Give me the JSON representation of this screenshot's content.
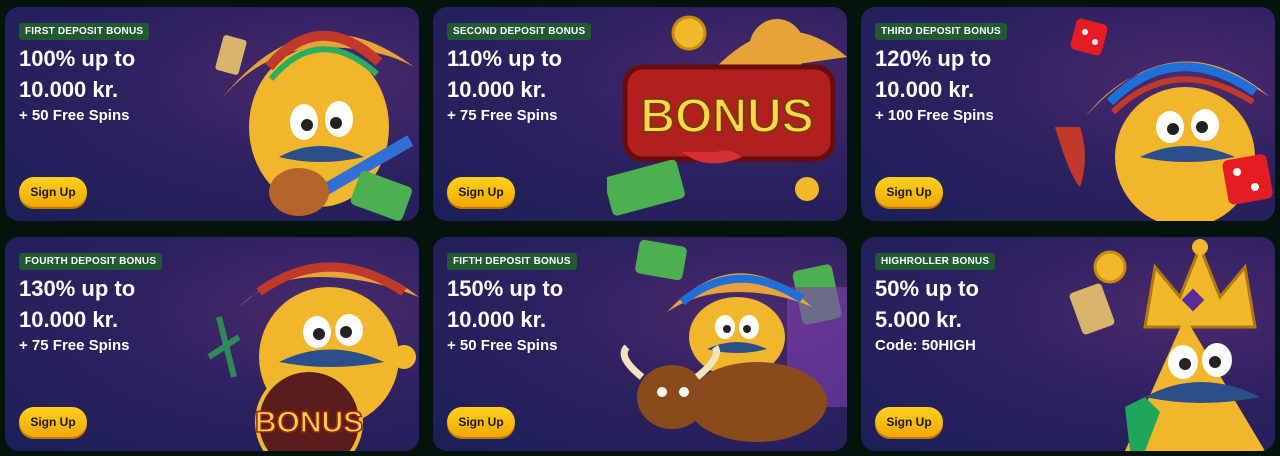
{
  "cards": [
    {
      "badge": "FIRST DEPOSIT BONUS",
      "line1": "100% up to",
      "line2": "10.000 kr.",
      "extra": "+ 50 Free Spins",
      "cta": "Sign Up"
    },
    {
      "badge": "SECOND DEPOSIT BONUS",
      "line1": "110% up to",
      "line2": "10.000 kr.",
      "extra": "+ 75 Free Spins",
      "cta": "Sign Up",
      "art_text": "BONUS"
    },
    {
      "badge": "THIRD DEPOSIT BONUS",
      "line1": "120% up to",
      "line2": "10.000 kr.",
      "extra": "+ 100 Free Spins",
      "cta": "Sign Up"
    },
    {
      "badge": "FOURTH DEPOSIT BONUS",
      "line1": "130% up to",
      "line2": "10.000 kr.",
      "extra": "+ 75 Free Spins",
      "cta": "Sign Up",
      "art_text": "BONUS"
    },
    {
      "badge": "FIFTH DEPOSIT BONUS",
      "line1": "150% up to",
      "line2": "10.000 kr.",
      "extra": "+ 50 Free Spins",
      "cta": "Sign Up"
    },
    {
      "badge": "HIGHROLLER BONUS",
      "line1": "50% up to",
      "line2": "5.000 kr.",
      "extra": "Code: 50HIGH",
      "cta": "Sign Up"
    }
  ],
  "colors": {
    "badge": "#1f5a33",
    "button": "#ffc107",
    "card": "#2e2160",
    "page": "#04140c"
  }
}
